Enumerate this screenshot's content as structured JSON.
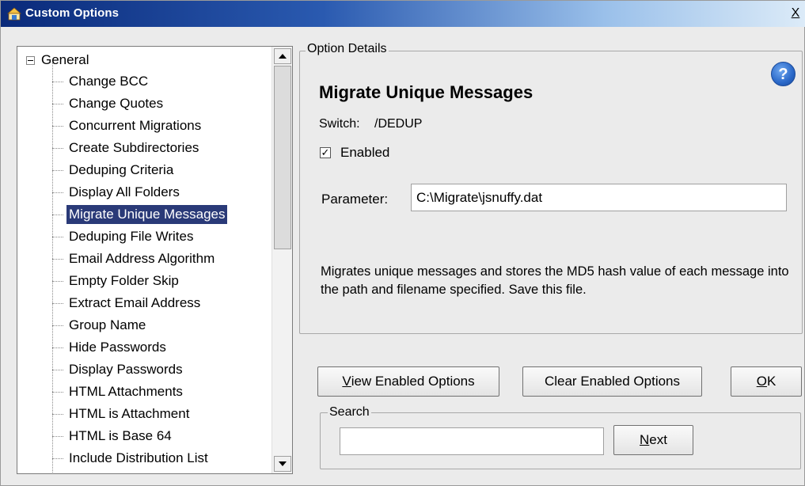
{
  "window": {
    "title": "Custom Options",
    "close_label": "X"
  },
  "tree": {
    "root_label": "General",
    "items": [
      "Change BCC",
      "Change Quotes",
      "Concurrent Migrations",
      "Create Subdirectories",
      "Deduping Criteria",
      "Display All Folders",
      "Migrate Unique Messages",
      "Deduping File Writes",
      "Email Address Algorithm",
      "Empty Folder Skip",
      "Extract Email Address",
      "Group Name",
      "Hide Passwords",
      "Display Passwords",
      "HTML Attachments",
      "HTML is Attachment",
      "HTML is Base 64",
      "Include Distribution List"
    ],
    "selected": "Migrate Unique Messages"
  },
  "details": {
    "legend": "Option Details",
    "title": "Migrate Unique Messages",
    "switch_label": "Switch:",
    "switch_value": "/DEDUP",
    "enabled_label": "Enabled",
    "enabled_checked": true,
    "parameter_label": "Parameter:",
    "parameter_value": "C:\\Migrate\\jsnuffy.dat",
    "description": "Migrates unique messages and stores the MD5 hash value of each message into the path and filename specified. Save this file.",
    "help_glyph": "?"
  },
  "buttons": {
    "view_enabled_prefix": "V",
    "view_enabled_rest": "iew Enabled Options",
    "clear_enabled": "Clear Enabled Options",
    "ok_prefix": "O",
    "ok_rest": "K"
  },
  "search": {
    "legend": "Search",
    "value": "",
    "next_prefix": "N",
    "next_rest": "ext"
  },
  "colors": {
    "selection_bg": "#2a3a78",
    "titlebar_start": "#0a2a7a"
  }
}
